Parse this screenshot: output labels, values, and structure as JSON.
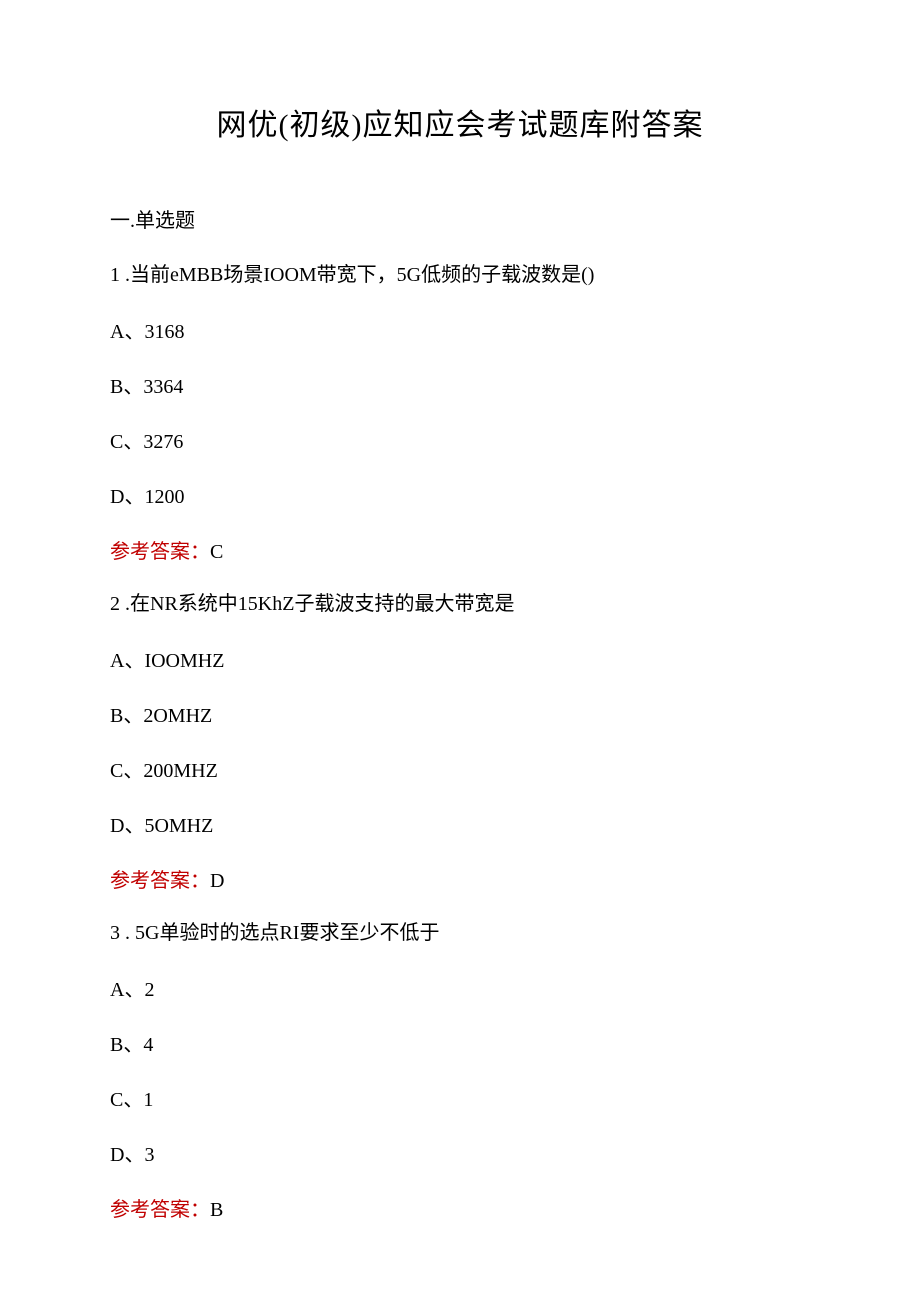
{
  "title": "网优(初级)应知应会考试题库附答案",
  "section_heading": "一.单选题",
  "answer_label": "参考答案：",
  "questions": [
    {
      "number": "1 .",
      "text": "当前eMBB场景IOOM带宽下，5G低频的子载波数是()",
      "options": {
        "A": "A、3168",
        "B": "B、3364",
        "C": "C、3276",
        "D": "D、1200"
      },
      "answer": "C"
    },
    {
      "number": "2 .",
      "text": "在NR系统中15KhZ子载波支持的最大带宽是",
      "options": {
        "A": "A、IOOMHZ",
        "B": "B、2OMHZ",
        "C": "C、200MHZ",
        "D": "D、5OMHZ"
      },
      "answer": "D"
    },
    {
      "number": "3 . ",
      "text": "5G单验时的选点RI要求至少不低于",
      "options": {
        "A": "A、2",
        "B": "B、4",
        "C": "C、1",
        "D": "D、3"
      },
      "answer": "B"
    }
  ]
}
